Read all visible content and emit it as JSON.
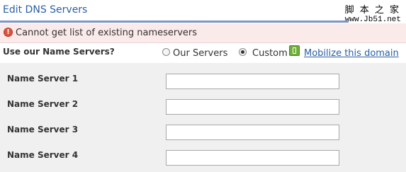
{
  "title": "Edit DNS Servers",
  "watermark": {
    "line1": "脚 本 之 家",
    "line2": "www.Jb51.net"
  },
  "error": {
    "icon": "exclamation-icon",
    "message": "Cannot get list of existing nameservers"
  },
  "nameservers_choice": {
    "label": "Use our Name Servers?",
    "options": [
      {
        "label": "Our Servers",
        "selected": false
      },
      {
        "label": "Custom",
        "selected": true
      }
    ],
    "mobilize_icon": "mobile-phone-icon",
    "mobilize_link": "Mobilize this domain"
  },
  "name_servers": [
    {
      "label": "Name Server 1",
      "value": ""
    },
    {
      "label": "Name Server 2",
      "value": ""
    },
    {
      "label": "Name Server 3",
      "value": ""
    },
    {
      "label": "Name Server 4",
      "value": ""
    }
  ],
  "colors": {
    "title": "#2a5fa4",
    "rule": "#7b96c6",
    "error_bg": "#fbeaea",
    "error_icon": "#d9533c",
    "panel_bg": "#f0f0f0",
    "link": "#2a5fa4"
  }
}
